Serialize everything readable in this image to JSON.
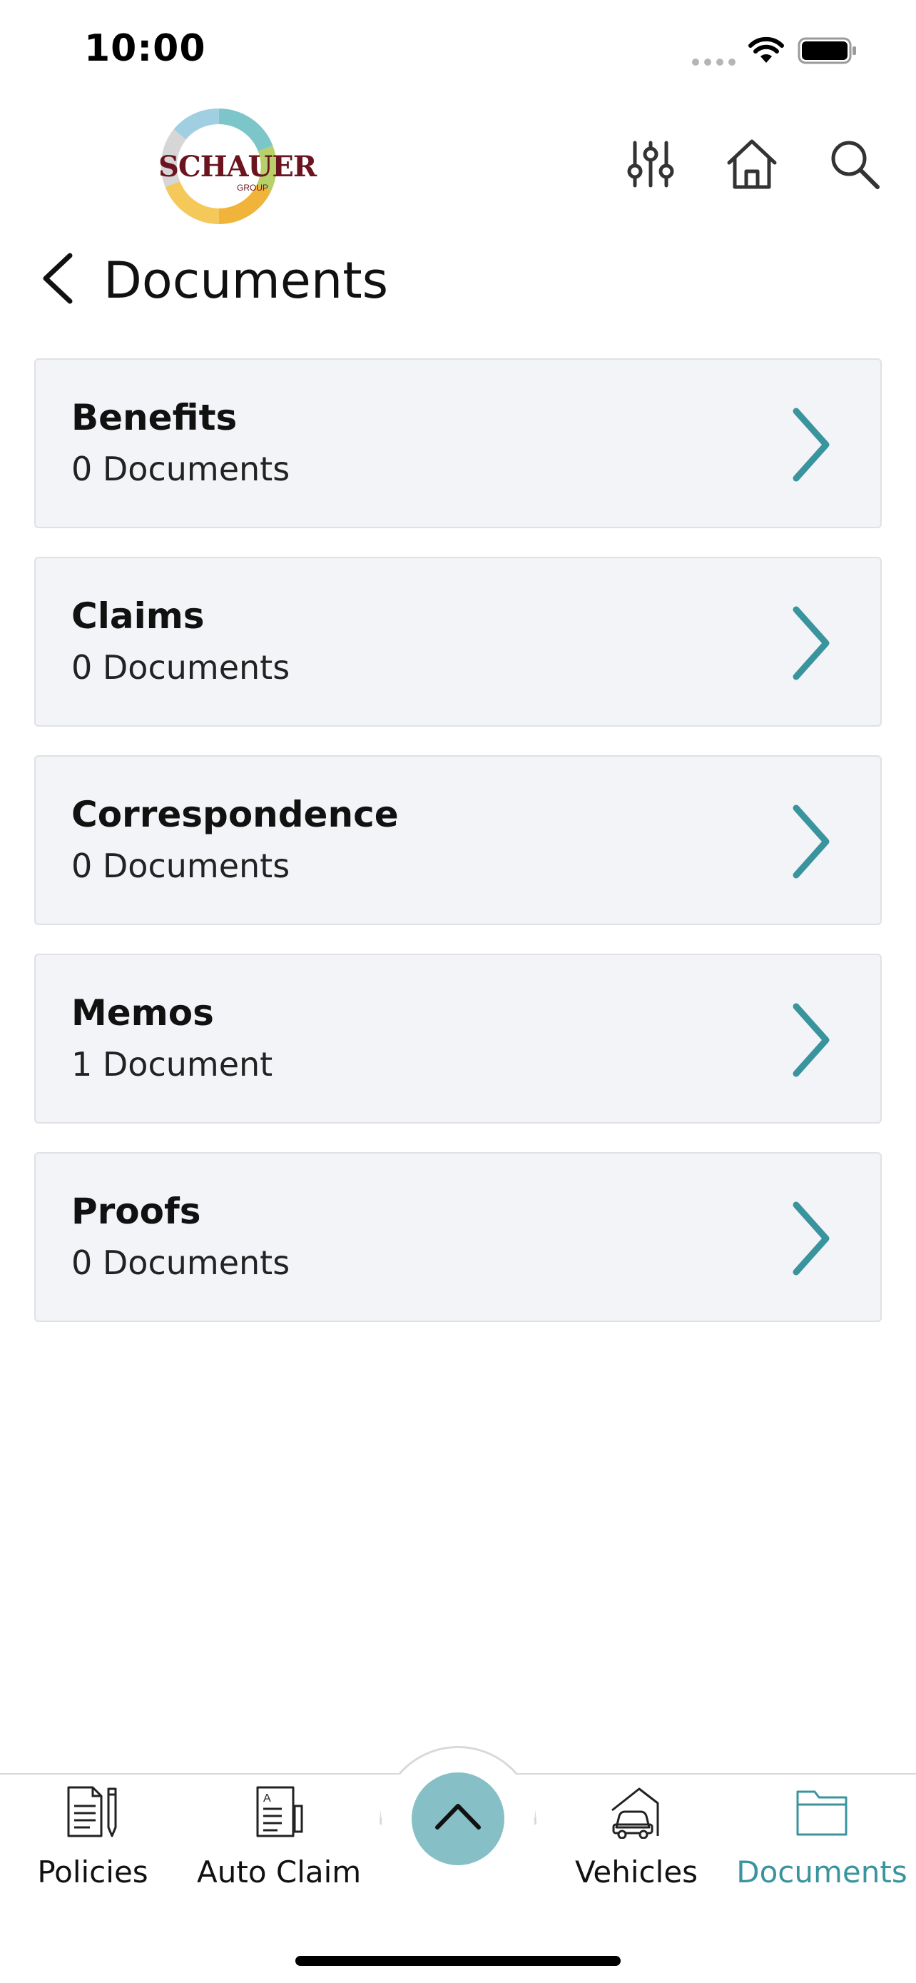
{
  "status_bar": {
    "time": "10:00"
  },
  "header": {
    "logo_text": "SCHAUER",
    "logo_subtext": "GROUP",
    "icons": [
      "sliders-icon",
      "home-icon",
      "search-icon"
    ]
  },
  "page": {
    "title": "Documents"
  },
  "categories": [
    {
      "title": "Benefits",
      "count": "0 Documents"
    },
    {
      "title": "Claims",
      "count": "0 Documents"
    },
    {
      "title": "Correspondence",
      "count": "0 Documents"
    },
    {
      "title": "Memos",
      "count": "1 Document"
    },
    {
      "title": "Proofs",
      "count": "0 Documents"
    }
  ],
  "bottom_nav": {
    "items": [
      {
        "label": "Policies",
        "icon": "policy-document-icon"
      },
      {
        "label": "Auto Claim",
        "icon": "auto-claim-form-icon"
      },
      {
        "label": "Vehicles",
        "icon": "vehicle-garage-icon"
      },
      {
        "label": "Documents",
        "icon": "folder-icon",
        "active": true
      }
    ],
    "center_button_icon": "chevron-up-icon"
  },
  "colors": {
    "accent": "#3a949e",
    "card_background": "#f3f4f7",
    "center_button": "#86bfc6",
    "logo_text": "#6b1420"
  }
}
